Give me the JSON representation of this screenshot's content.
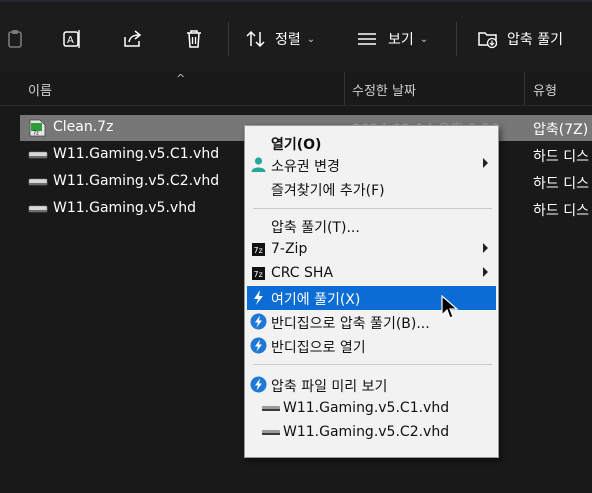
{
  "toolbar": {
    "sort_label": "정렬",
    "view_label": "보기",
    "extract_label": "압축 풀기"
  },
  "columns": {
    "name": "이름",
    "modified": "수정한 날짜",
    "type": "유형"
  },
  "files": [
    {
      "name": "Clean.7z",
      "date": "2024-02-14 오후 9:56",
      "type": "압축(7Z)",
      "icon": "7z-archive-icon",
      "selected": true
    },
    {
      "name": "W11.Gaming.v5.C1.vhd",
      "date": "",
      "type": "하드 디스",
      "icon": "vhd-disk-icon",
      "selected": false
    },
    {
      "name": "W11.Gaming.v5.C2.vhd",
      "date": "",
      "type": "하드 디스",
      "icon": "vhd-disk-icon",
      "selected": false
    },
    {
      "name": "W11.Gaming.v5.vhd",
      "date": "",
      "type": "하드 디스",
      "icon": "vhd-disk-icon",
      "selected": false
    }
  ],
  "context_menu": {
    "open": "열기(O)",
    "change_owner": "소유권 변경",
    "add_favorites": "즐겨찾기에 추가(F)",
    "extract": "압축 풀기(T)...",
    "seven_zip": "7-Zip",
    "crc_sha": "CRC SHA",
    "extract_here": "여기에 풀기(X)",
    "bandizip_extract": "반디집으로 압축 풀기(B)...",
    "bandizip_open": "반디집으로 열기",
    "preview": "압축 파일 미리 보기",
    "preview_items": [
      "W11.Gaming.v5.C1.vhd",
      "W11.Gaming.v5.C2.vhd"
    ]
  },
  "colors": {
    "highlight": "#0a6cd4",
    "bandizip_blue": "#1e78d6",
    "selected_row": "#777777"
  }
}
